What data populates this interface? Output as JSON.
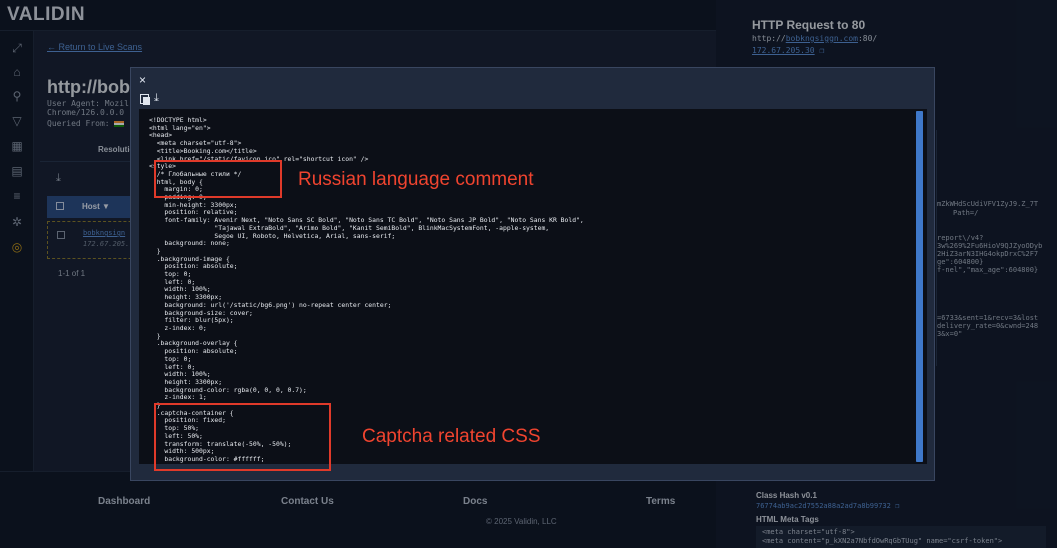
{
  "app": {
    "logo": "VALIDIN"
  },
  "main": {
    "back_link": "← Return to Live Scans",
    "title": "http://bobkn",
    "user_agent": "User Agent: Mozil",
    "chrome": "Chrome/126.0.0.0",
    "queried_from": "Queried From:",
    "tab_resolution": "Resolution",
    "table": {
      "host_header": "Host",
      "row_host": "bobkngsign",
      "row_ip": "172.67.205."
    },
    "pager": "1-1 of 1"
  },
  "right_panel": {
    "title": "HTTP Request to 80",
    "url_prefix": "http://",
    "url_host": "bobkngsiggn.com",
    "url_suffix": ":80/",
    "ip": "172.67.205.30",
    "fragments": [
      "mZkWHdScUdiVFV1ZyJ9.Z_7T",
      "Path=/",
      "",
      "",
      "report\\/v4?",
      "3w%269%2Fu6HioV9QJZyoODyb",
      "2HiZ3arN3IHG4okpDrxC%2F7",
      "ge\":604800}",
      "f-nel\",\"max_age\":604800}",
      "",
      "",
      "",
      "=6733&sent=1&recv=3&lost",
      "delivery_rate=0&cwnd=248",
      "3&x=0\""
    ],
    "class_hash_label": "Class Hash v0.1",
    "class_hash_value": "76774ab9ac2d7552a88a2ad7a8b99732",
    "meta_tags_label": "HTML Meta Tags",
    "meta_line1": "<meta charset=\"utf-8\">",
    "meta_line2": "<meta content=\"p_kXN2a7NbfdOwRqGbTUug\" name=\"csrf-token\">"
  },
  "footer": {
    "dashboard": "Dashboard",
    "contact": "Contact Us",
    "docs": "Docs",
    "terms": "Terms",
    "copyright": "© 2025 Validin, LLC"
  },
  "modal": {
    "close": "×",
    "code_lines": [
      "<!DOCTYPE html>",
      "<html lang=\"en\">",
      "<head>",
      "  <meta charset=\"utf-8\">",
      "  <title>Booking.com</title>",
      "  <link href=\"/static/favicon.ico\" rel=\"shortcut icon\" />",
      "<style>",
      "  /* Глобальные стили */",
      "  html, body {",
      "    margin: 0;",
      "    padding: 0;",
      "    min-height: 3300px;",
      "    position: relative;",
      "    font-family: Avenir Next, \"Noto Sans SC Bold\", \"Noto Sans TC Bold\", \"Noto Sans JP Bold\", \"Noto Sans KR Bold\",",
      "                 \"Tajawal ExtraBold\", \"Arimo Bold\", \"Kanit SemiBold\", BlinkMacSystemFont, -apple-system,",
      "                 Segoe UI, Roboto, Helvetica, Arial, sans-serif;",
      "    background: none;",
      "  }",
      "  .background-image {",
      "    position: absolute;",
      "    top: 0;",
      "    left: 0;",
      "    width: 100%;",
      "    height: 3300px;",
      "    background: url('/static/bg6.png') no-repeat center center;",
      "    background-size: cover;",
      "    filter: blur(5px);",
      "    z-index: 0;",
      "  }",
      "  .background-overlay {",
      "    position: absolute;",
      "    top: 0;",
      "    left: 0;",
      "    width: 100%;",
      "    height: 3300px;",
      "    background-color: rgba(0, 0, 0, 0.7);",
      "    z-index: 1;",
      "  }",
      "  .captcha-container {",
      "    position: fixed;",
      "    top: 50%;",
      "    left: 50%;",
      "    transform: translate(-50%, -50%);",
      "    width: 500px;",
      "    background-color: #ffffff;"
    ]
  },
  "annotations": {
    "russian": "Russian language comment",
    "captcha": "Captcha related CSS"
  }
}
